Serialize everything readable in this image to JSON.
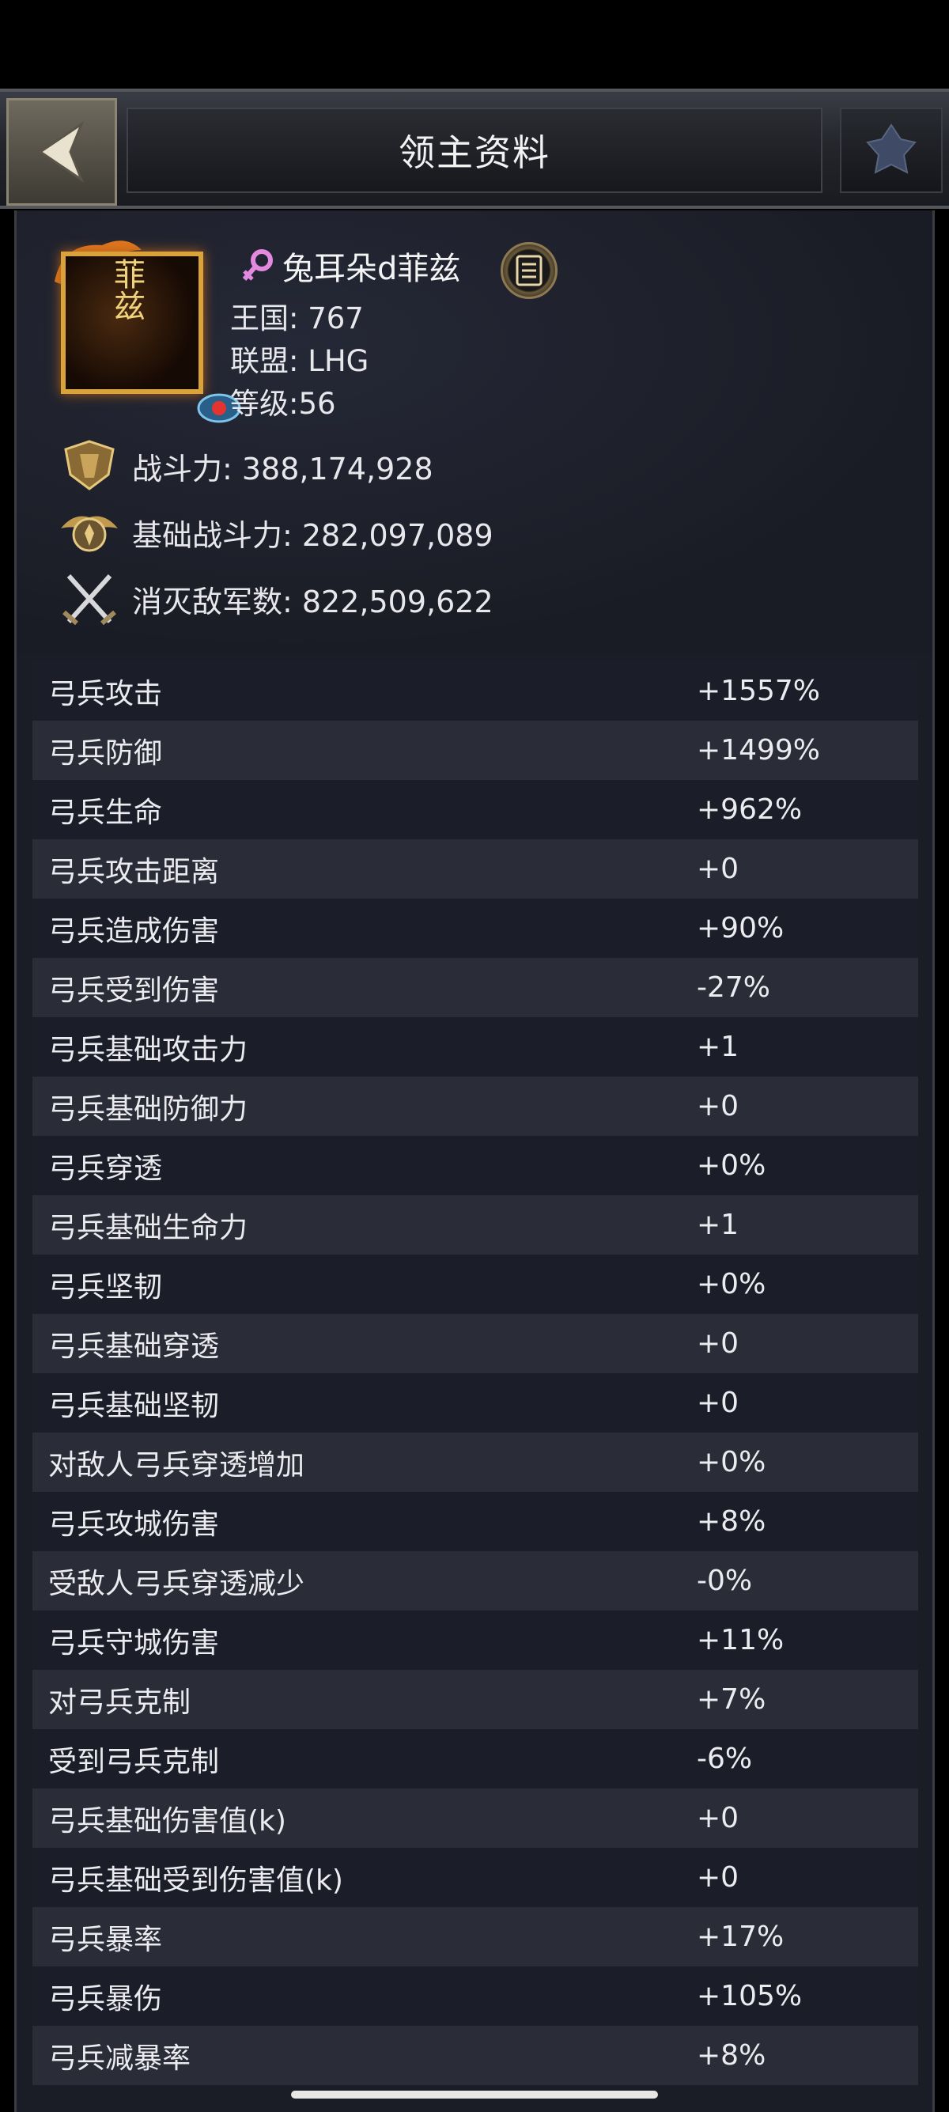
{
  "header": {
    "title": "领主资料",
    "back_icon": "back-arrow-icon",
    "crest_icon": "guild-crest-icon"
  },
  "profile": {
    "avatar_text": "菲兹",
    "gender_icon": "female-icon",
    "name": "兔耳朵d菲兹",
    "info_icon": "list-info-icon",
    "kingdom": "王国: 767",
    "alliance": "联盟: LHG",
    "level": "等级:56",
    "power": "战斗力: 388,174,928",
    "base_power": "基础战斗力: 282,097,089",
    "kills": "消灭敌军数: 822,509,622"
  },
  "stats": [
    {
      "label": "弓兵攻击",
      "value": "+1557%"
    },
    {
      "label": "弓兵防御",
      "value": "+1499%"
    },
    {
      "label": "弓兵生命",
      "value": "+962%"
    },
    {
      "label": "弓兵攻击距离",
      "value": "+0"
    },
    {
      "label": "弓兵造成伤害",
      "value": "+90%"
    },
    {
      "label": "弓兵受到伤害",
      "value": "-27%"
    },
    {
      "label": "弓兵基础攻击力",
      "value": "+1"
    },
    {
      "label": "弓兵基础防御力",
      "value": "+0"
    },
    {
      "label": "弓兵穿透",
      "value": "+0%"
    },
    {
      "label": "弓兵基础生命力",
      "value": "+1"
    },
    {
      "label": "弓兵坚韧",
      "value": "+0%"
    },
    {
      "label": "弓兵基础穿透",
      "value": "+0"
    },
    {
      "label": "弓兵基础坚韧",
      "value": "+0"
    },
    {
      "label": "对敌人弓兵穿透增加",
      "value": "+0%"
    },
    {
      "label": "弓兵攻城伤害",
      "value": "+8%"
    },
    {
      "label": "受敌人弓兵穿透减少",
      "value": "-0%"
    },
    {
      "label": "弓兵守城伤害",
      "value": "+11%"
    },
    {
      "label": "对弓兵克制",
      "value": "+7%"
    },
    {
      "label": "受到弓兵克制",
      "value": "-6%"
    },
    {
      "label": "弓兵基础伤害值(k)",
      "value": "+0"
    },
    {
      "label": "弓兵基础受到伤害值(k)",
      "value": "+0"
    },
    {
      "label": "弓兵暴率",
      "value": "+17%"
    },
    {
      "label": "弓兵暴伤",
      "value": "+105%"
    },
    {
      "label": "弓兵减暴率",
      "value": "+8%"
    }
  ],
  "colors": {
    "gold": "#d9a23a",
    "row_dark": "#1b1e29",
    "row_light": "#2a2d38"
  }
}
